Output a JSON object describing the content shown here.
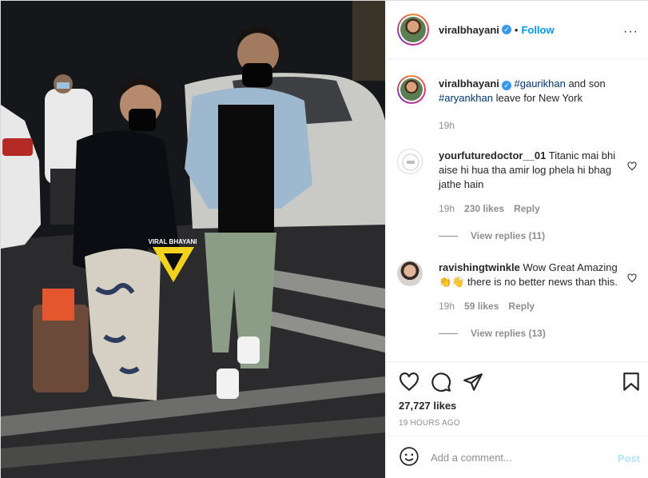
{
  "post": {
    "username": "viralbhayani",
    "verified_icon": "verified-badge-icon",
    "separator": "•",
    "follow_label": "Follow",
    "more_icon": "more-options-icon",
    "more_glyph": "···",
    "watermark_text": "VIRAL BHAYANI"
  },
  "caption": {
    "username": "viralbhayani",
    "tag1": "#gaurikhan",
    "text1": " and son",
    "tag2": "#aryankhan",
    "text2": " leave for New York",
    "time": "19h"
  },
  "comments": [
    {
      "username": "yourfuturedoctor__01",
      "text": "Titanic mai bhi aise hi hua tha amir log phela hi bhag jathe hain",
      "time": "19h",
      "likes": "230 likes",
      "reply_label": "Reply",
      "view_replies": "View replies (11)"
    },
    {
      "username": "ravishingtwinkle",
      "text": "Wow Great Amazing 👏👋 there is no better news than this.",
      "time": "19h",
      "likes": "59 likes",
      "reply_label": "Reply",
      "view_replies": "View replies (13)"
    }
  ],
  "actions": {
    "likes": "27,727 likes",
    "timestamp": "19 HOURS AGO"
  },
  "add_comment": {
    "placeholder": "Add a comment...",
    "post_label": "Post"
  },
  "colors": {
    "accent": "#0095f6",
    "post_disabled": "#b2dffc",
    "hashtag": "#00376b",
    "watermark": "#f2d21b"
  }
}
